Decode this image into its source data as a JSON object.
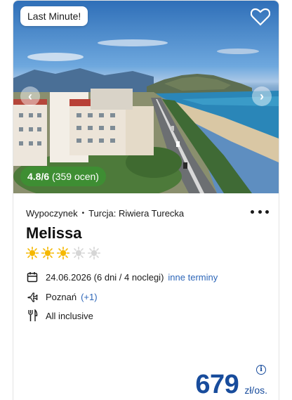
{
  "offer": {
    "badge": "Last Minute!",
    "rating": {
      "score": "4.8/6",
      "reviews": "(359 ocen)"
    },
    "operator": "Wypoczynek",
    "separator": "•",
    "destination": "Turcja: Riwiera Turecka",
    "hotel_name": "Melissa",
    "stars": {
      "filled": 3,
      "total": 5,
      "filled_color": "#f5b800",
      "empty_color": "#d6d6d6"
    },
    "date": "24.06.2026 (6 dni / 4 noclegi)",
    "other_dates_link": "inne terminy",
    "departure_city": "Poznań",
    "departure_more": "(+1)",
    "board": "All inclusive",
    "price": "679",
    "currency": "zł/os."
  },
  "icons": {
    "favorite": "heart-icon",
    "prev": "chevron-left-icon",
    "next": "chevron-right-icon",
    "more": "more-options-icon",
    "calendar": "calendar-icon",
    "flight": "plane-icon",
    "board": "cutlery-icon",
    "info": "info-icon"
  },
  "colors": {
    "accent": "#2d66b8",
    "price": "#184c9c",
    "rating_bg": "#3e8e33"
  }
}
